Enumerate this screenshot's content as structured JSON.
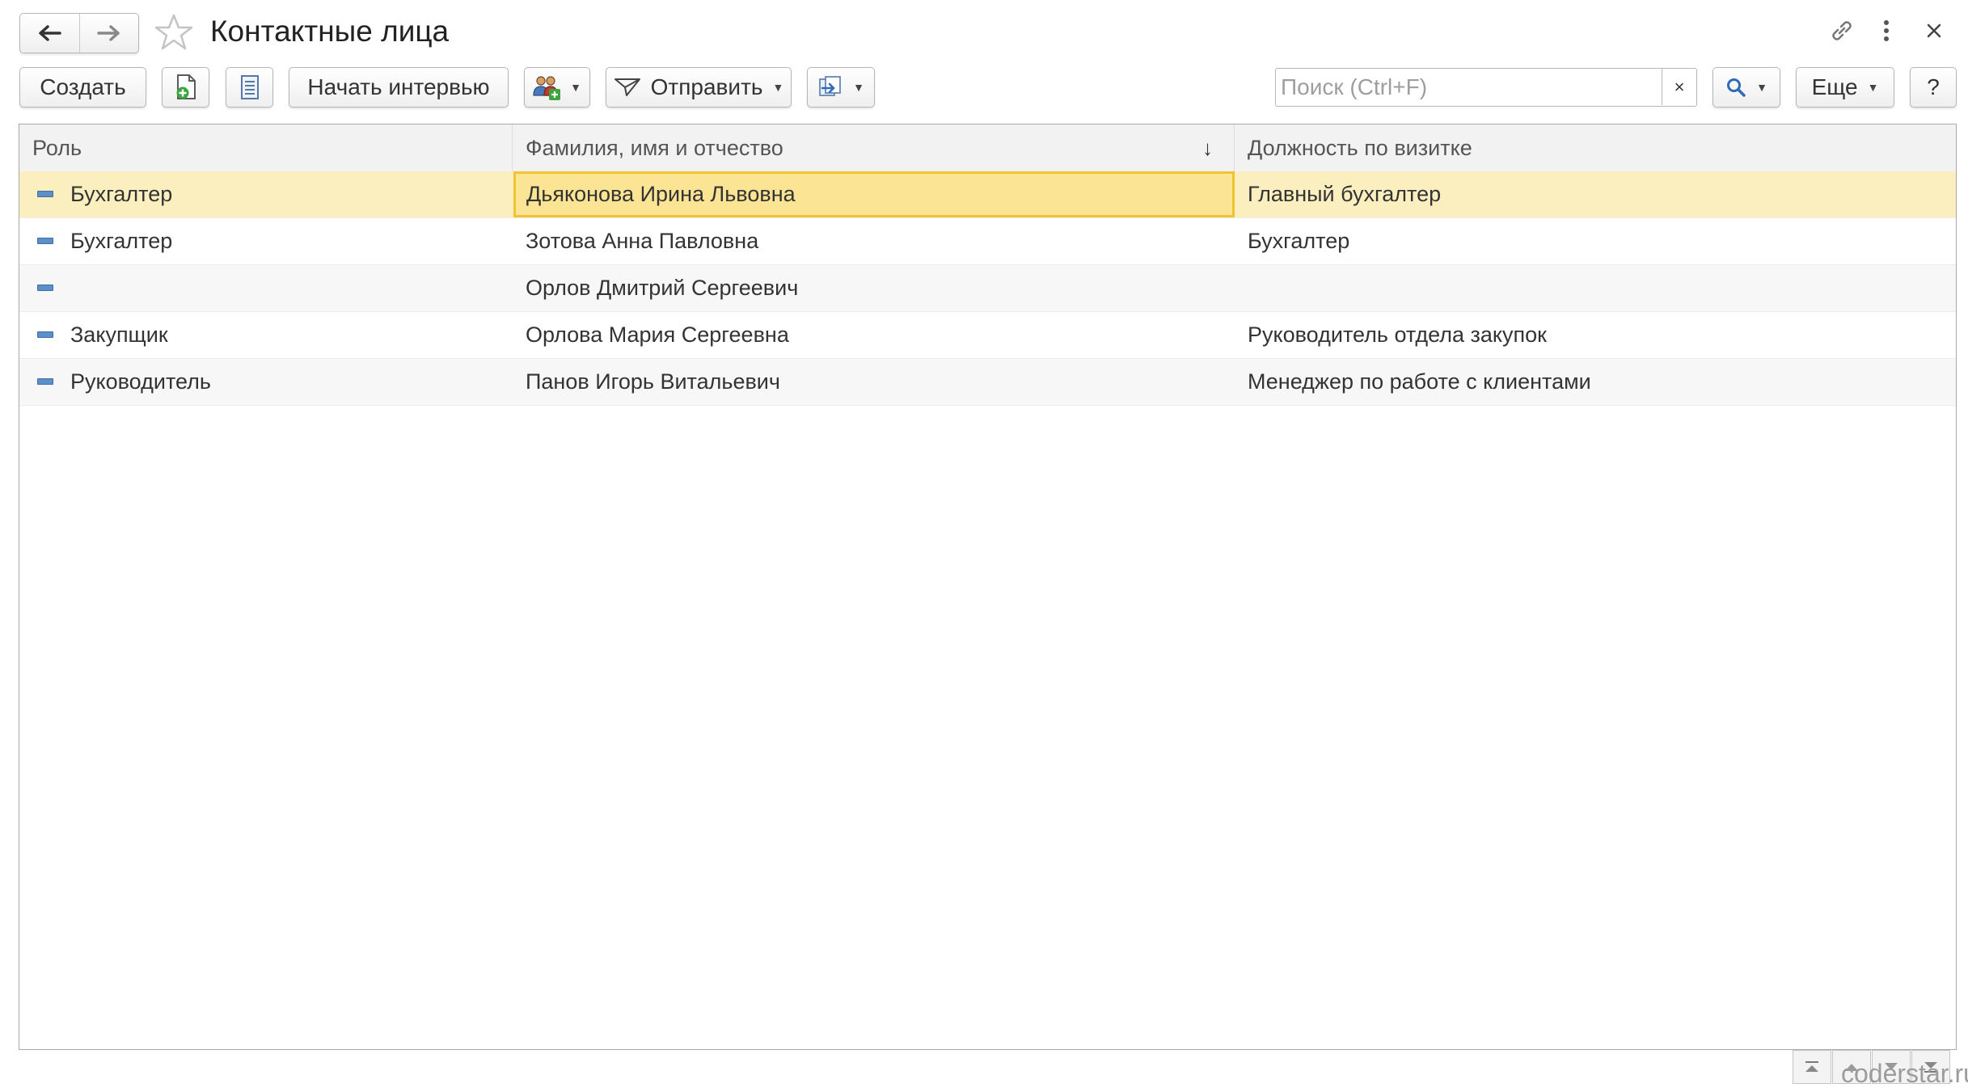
{
  "window": {
    "title": "Контактные лица"
  },
  "toolbar": {
    "create_label": "Создать",
    "interview_label": "Начать интервью",
    "send_label": "Отправить",
    "more_label": "Еще",
    "help_label": "?"
  },
  "search": {
    "placeholder": "Поиск (Ctrl+F)",
    "value": "",
    "clear_label": "×"
  },
  "table": {
    "columns": [
      "Роль",
      "Фамилия, имя и отчество",
      "Должность по визитке"
    ],
    "sort_indicator": "↓",
    "rows": [
      {
        "role": "Бухгалтер",
        "name": "Дьяконова Ирина Львовна",
        "position": "Главный бухгалтер"
      },
      {
        "role": "Бухгалтер",
        "name": "Зотова Анна Павловна",
        "position": "Бухгалтер"
      },
      {
        "role": "",
        "name": "Орлов Дмитрий Сергеевич",
        "position": ""
      },
      {
        "role": "Закупщик",
        "name": "Орлова Мария Сергеевна",
        "position": "Руководитель отдела закупок"
      },
      {
        "role": "Руководитель",
        "name": "Панов Игорь Витальевич",
        "position": "Менеджер по работе с клиентами"
      }
    ],
    "selected_row": 0
  },
  "icons": {
    "back": "arrow-left-icon",
    "forward": "arrow-right-icon",
    "favorite": "star-outline-icon",
    "link": "link-icon",
    "menu": "kebab-menu-icon",
    "close": "close-icon",
    "row": "row-marker-icon"
  },
  "colors": {
    "selected_row": "#fbefbf",
    "active_cell": "#fbe493",
    "active_border": "#f1c232",
    "row_icon": "#5b8fc7"
  },
  "watermark": "coderstar.ru"
}
